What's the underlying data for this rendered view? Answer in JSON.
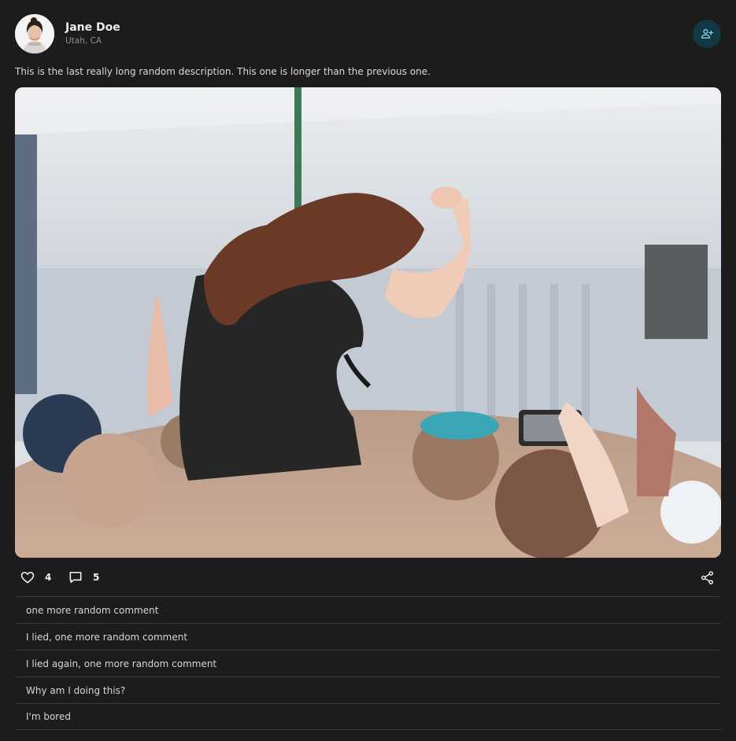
{
  "user": {
    "name": "Jane Doe",
    "location": "Utah, CA"
  },
  "icons": {
    "follow": "person-add-icon",
    "like": "heart-outline-icon",
    "comment": "comment-bubble-icon",
    "share": "share-icon"
  },
  "colors": {
    "background": "#1c1c1d",
    "follow_button_bg": "#0f3a45",
    "follow_icon": "#8fd6e6"
  },
  "post": {
    "description": "This is the last really long random description. This one is longer than the previous one.",
    "likes": "4",
    "comments_count": "5"
  },
  "comments": [
    "one more random comment",
    "I lied, one more random comment",
    "I lied again, one more random comment",
    "Why am I doing this?",
    "I'm bored"
  ]
}
